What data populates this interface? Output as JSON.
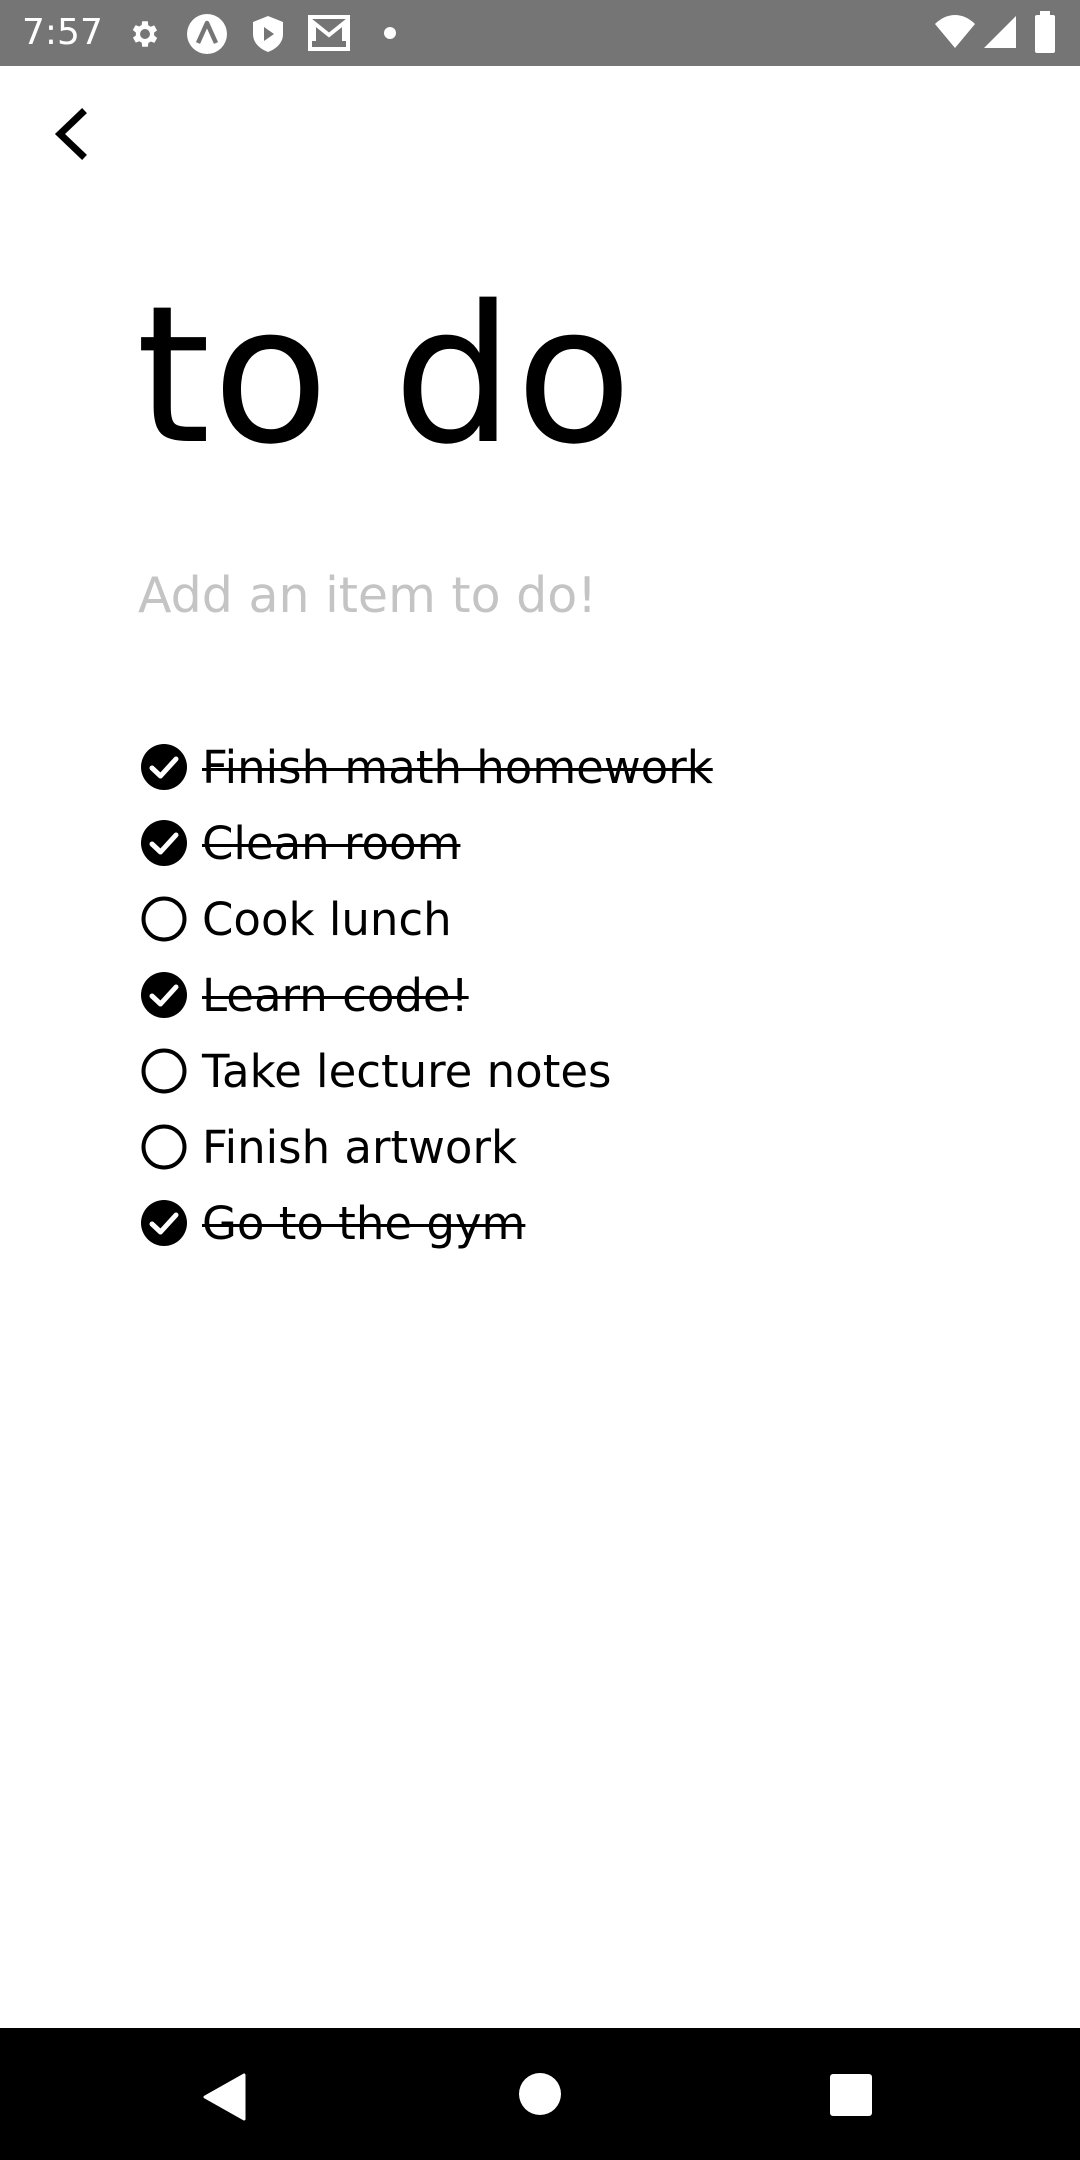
{
  "status_bar": {
    "time": "7:57",
    "icons_left": [
      "gear-icon",
      "nav-arrow-icon",
      "shield-icon",
      "gmail-icon",
      "dot-icon"
    ],
    "icons_right": [
      "wifi-icon",
      "signal-icon",
      "battery-icon"
    ],
    "background": "#757575"
  },
  "header": {
    "back_icon": "chevron-left-icon"
  },
  "title": "to do",
  "add_item": {
    "value": "",
    "placeholder": "Add an item to do!"
  },
  "items": [
    {
      "label": "Finish math homework",
      "done": true
    },
    {
      "label": "Clean room",
      "done": true
    },
    {
      "label": "Cook lunch",
      "done": false
    },
    {
      "label": "Learn code!",
      "done": true
    },
    {
      "label": "Take lecture notes",
      "done": false
    },
    {
      "label": "Finish artwork",
      "done": false
    },
    {
      "label": "Go to the gym",
      "done": true
    }
  ],
  "nav_bar": {
    "buttons": [
      "back-triangle-icon",
      "home-circle-icon",
      "recents-square-icon"
    ],
    "background": "#000000"
  }
}
